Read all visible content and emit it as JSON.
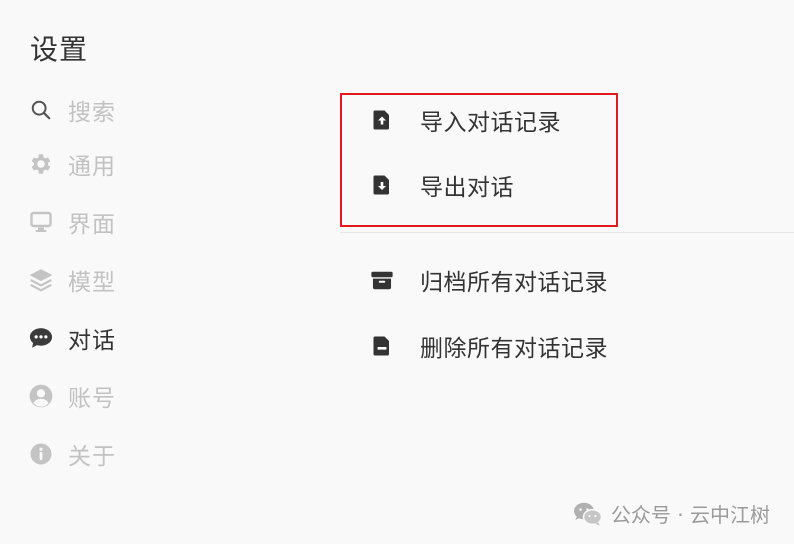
{
  "title": "设置",
  "sidebar": {
    "items": [
      {
        "label": "搜索",
        "icon": "search-icon"
      },
      {
        "label": "通用",
        "icon": "gear-icon"
      },
      {
        "label": "界面",
        "icon": "monitor-icon"
      },
      {
        "label": "模型",
        "icon": "layers-icon"
      },
      {
        "label": "对话",
        "icon": "chat-bubble-icon",
        "active": true
      },
      {
        "label": "账号",
        "icon": "user-circle-icon"
      },
      {
        "label": "关于",
        "icon": "info-icon"
      }
    ]
  },
  "actions": {
    "import_label": "导入对话记录",
    "export_label": "导出对话",
    "archive_label": "归档所有对话记录",
    "delete_label": "删除所有对话记录"
  },
  "watermark": {
    "text": "公众号 · 云中江树"
  },
  "colors": {
    "highlight": "#e11a1f",
    "inactive_text": "#c2c2c2",
    "active_text": "#333333",
    "background": "#f9f9f9"
  }
}
